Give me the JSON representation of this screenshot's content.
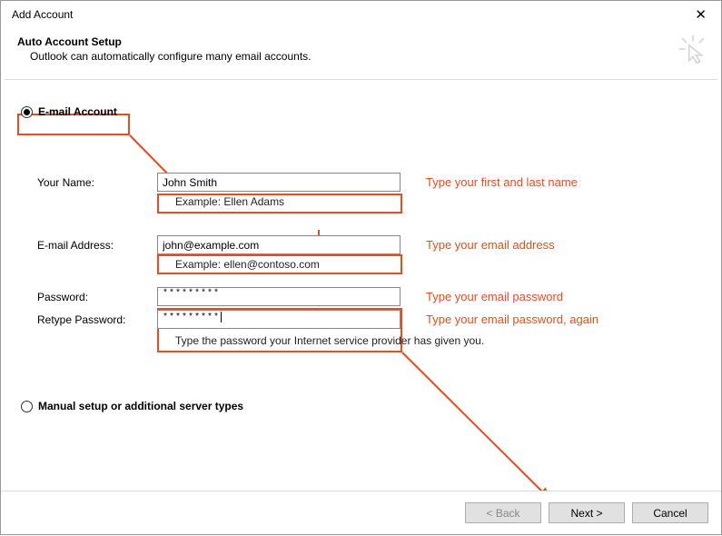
{
  "window": {
    "title": "Add Account"
  },
  "header": {
    "title": "Auto Account Setup",
    "subtitle": "Outlook can automatically configure many email accounts."
  },
  "radios": {
    "email_account": "E-mail Account",
    "manual_setup": "Manual setup or additional server types"
  },
  "form": {
    "name_label": "Your Name:",
    "name_value": "John Smith",
    "name_example": "Example: Ellen Adams",
    "name_annot": "Type your first and last name",
    "email_label": "E-mail Address:",
    "email_value": "john@example.com",
    "email_example": "Example: ellen@contoso.com",
    "email_annot": "Type your email address",
    "pw_label": "Password:",
    "pw_value": "*********",
    "pw_annot": "Type your email password",
    "pw2_label": "Retype Password:",
    "pw2_value": "*********",
    "pw2_annot": "Type your email password, again",
    "pw_notice": "Type the password your Internet service provider has given you."
  },
  "footer": {
    "back": "< Back",
    "next": "Next >",
    "cancel": "Cancel"
  }
}
